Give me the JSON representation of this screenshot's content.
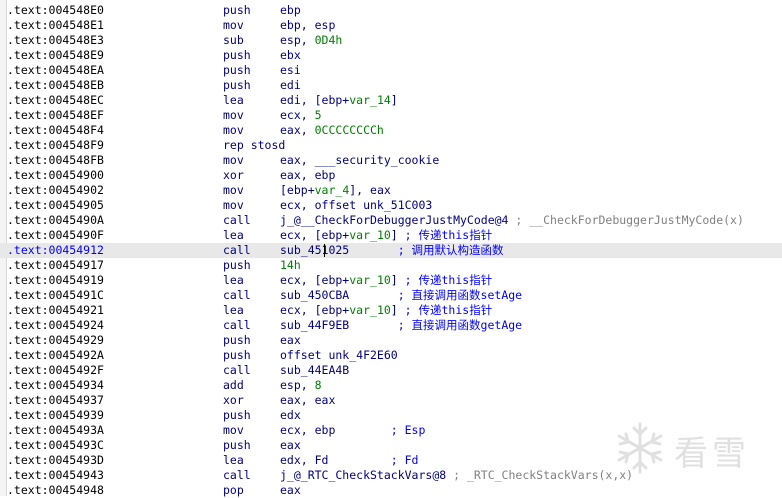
{
  "listing": [
    {
      "addr": ".text:004548E0",
      "mn": "push",
      "parts": [
        {
          "t": "ebp"
        }
      ]
    },
    {
      "addr": ".text:004548E1",
      "mn": "mov",
      "parts": [
        {
          "t": "ebp, esp"
        }
      ]
    },
    {
      "addr": ".text:004548E3",
      "mn": "sub",
      "parts": [
        {
          "t": "esp, "
        },
        {
          "t": "0D4h",
          "c": "n"
        }
      ]
    },
    {
      "addr": ".text:004548E9",
      "mn": "push",
      "parts": [
        {
          "t": "ebx"
        }
      ]
    },
    {
      "addr": ".text:004548EA",
      "mn": "push",
      "parts": [
        {
          "t": "esi"
        }
      ]
    },
    {
      "addr": ".text:004548EB",
      "mn": "push",
      "parts": [
        {
          "t": "edi"
        }
      ]
    },
    {
      "addr": ".text:004548EC",
      "mn": "lea",
      "parts": [
        {
          "t": "edi, [ebp+"
        },
        {
          "t": "var_14",
          "c": "v"
        },
        {
          "t": "]"
        }
      ]
    },
    {
      "addr": ".text:004548EF",
      "mn": "mov",
      "parts": [
        {
          "t": "ecx, "
        },
        {
          "t": "5",
          "c": "n"
        }
      ]
    },
    {
      "addr": ".text:004548F4",
      "mn": "mov",
      "parts": [
        {
          "t": "eax, "
        },
        {
          "t": "0CCCCCCCCh",
          "c": "n"
        }
      ]
    },
    {
      "addr": ".text:004548F9",
      "mn": "rep stosd",
      "parts": []
    },
    {
      "addr": ".text:004548FB",
      "mn": "mov",
      "parts": [
        {
          "t": "eax, ___security_cookie"
        }
      ]
    },
    {
      "addr": ".text:00454900",
      "mn": "xor",
      "parts": [
        {
          "t": "eax, ebp"
        }
      ]
    },
    {
      "addr": ".text:00454902",
      "mn": "mov",
      "parts": [
        {
          "t": "[ebp+"
        },
        {
          "t": "var_4",
          "c": "v"
        },
        {
          "t": "], eax"
        }
      ]
    },
    {
      "addr": ".text:00454905",
      "mn": "mov",
      "parts": [
        {
          "t": "ecx, offset unk_51C003"
        }
      ]
    },
    {
      "addr": ".text:0045490A",
      "mn": "call",
      "parts": [
        {
          "t": "j_@__CheckForDebuggerJustMyCode@4"
        },
        {
          "t": " ; __CheckForDebuggerJustMyCode(x)",
          "c": "cmg"
        }
      ]
    },
    {
      "addr": ".text:0045490F",
      "mn": "lea",
      "parts": [
        {
          "t": "ecx, [ebp+"
        },
        {
          "t": "var_10",
          "c": "v"
        },
        {
          "t": "]"
        },
        {
          "t": " ; 传递this指针",
          "c": "cm"
        }
      ]
    },
    {
      "addr": ".text:00454912",
      "mn": "call",
      "parts": [
        {
          "t": "sub_451025"
        },
        {
          "t": "       ; 调用默认构造函数",
          "c": "cm"
        }
      ],
      "hl": true
    },
    {
      "addr": ".text:00454917",
      "mn": "push",
      "parts": [
        {
          "t": "14h",
          "c": "n"
        }
      ]
    },
    {
      "addr": ".text:00454919",
      "mn": "lea",
      "parts": [
        {
          "t": "ecx, [ebp+"
        },
        {
          "t": "var_10",
          "c": "v"
        },
        {
          "t": "]"
        },
        {
          "t": " ; 传递this指针",
          "c": "cm"
        }
      ]
    },
    {
      "addr": ".text:0045491C",
      "mn": "call",
      "parts": [
        {
          "t": "sub_450CBA"
        },
        {
          "t": "       ; 直接调用函数setAge",
          "c": "cm"
        }
      ]
    },
    {
      "addr": ".text:00454921",
      "mn": "lea",
      "parts": [
        {
          "t": "ecx, [ebp+"
        },
        {
          "t": "var_10",
          "c": "v"
        },
        {
          "t": "]"
        },
        {
          "t": " ; 传递this指针",
          "c": "cm"
        }
      ]
    },
    {
      "addr": ".text:00454924",
      "mn": "call",
      "parts": [
        {
          "t": "sub_44F9EB"
        },
        {
          "t": "       ; 直接调用函数getAge",
          "c": "cm"
        }
      ]
    },
    {
      "addr": ".text:00454929",
      "mn": "push",
      "parts": [
        {
          "t": "eax"
        }
      ]
    },
    {
      "addr": ".text:0045492A",
      "mn": "push",
      "parts": [
        {
          "t": "offset unk_4F2E60"
        }
      ]
    },
    {
      "addr": ".text:0045492F",
      "mn": "call",
      "parts": [
        {
          "t": "sub_44EA4B"
        }
      ]
    },
    {
      "addr": ".text:00454934",
      "mn": "add",
      "parts": [
        {
          "t": "esp, "
        },
        {
          "t": "8",
          "c": "n"
        }
      ]
    },
    {
      "addr": ".text:00454937",
      "mn": "xor",
      "parts": [
        {
          "t": "eax, eax"
        }
      ]
    },
    {
      "addr": ".text:00454939",
      "mn": "push",
      "parts": [
        {
          "t": "edx"
        }
      ]
    },
    {
      "addr": ".text:0045493A",
      "mn": "mov",
      "parts": [
        {
          "t": "ecx, ebp"
        },
        {
          "t": "        ; Esp",
          "c": "cm"
        }
      ]
    },
    {
      "addr": ".text:0045493C",
      "mn": "push",
      "parts": [
        {
          "t": "eax"
        }
      ]
    },
    {
      "addr": ".text:0045493D",
      "mn": "lea",
      "parts": [
        {
          "t": "edx, Fd"
        },
        {
          "t": "         ; Fd",
          "c": "cm"
        }
      ]
    },
    {
      "addr": ".text:00454943",
      "mn": "call",
      "parts": [
        {
          "t": "j_@_RTC_CheckStackVars@8"
        },
        {
          "t": " ; _RTC_CheckStackVars(x,x)",
          "c": "cmg"
        }
      ]
    },
    {
      "addr": ".text:00454948",
      "mn": "pop",
      "parts": [
        {
          "t": "eax"
        }
      ]
    }
  ],
  "watermark": {
    "text": "看雪",
    "icon": "snowflake-icon"
  }
}
